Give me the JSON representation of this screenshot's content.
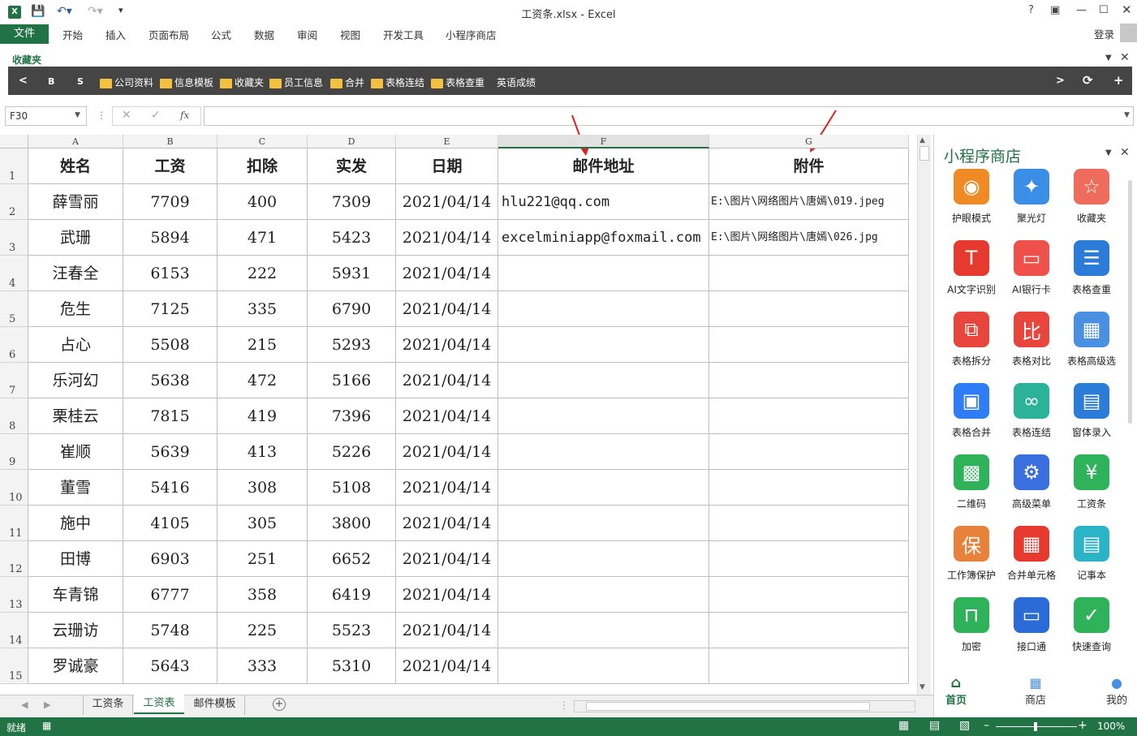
{
  "window": {
    "title": "工资条.xlsx - Excel",
    "signin": "登录",
    "help": "?"
  },
  "ribbon": {
    "file": "文件",
    "tabs": [
      "开始",
      "插入",
      "页面布局",
      "公式",
      "数据",
      "审阅",
      "视图",
      "开发工具",
      "小程序商店"
    ]
  },
  "favorites": {
    "label": "收藏夹",
    "nav_left": "<",
    "b": "B",
    "s": "S",
    "items": [
      "公司资料",
      "信息模板",
      "收藏夹",
      "员工信息",
      "合并",
      "表格连结",
      "表格查重"
    ],
    "extra": "英语成绩",
    "nav_right": ">",
    "refresh": "⟳",
    "add": "+"
  },
  "formula_bar": {
    "name_box": "F30",
    "fx": "fx",
    "value": ""
  },
  "sheet": {
    "columns": [
      "A",
      "B",
      "C",
      "D",
      "E",
      "F",
      "G"
    ],
    "headers": [
      "姓名",
      "工资",
      "扣除",
      "实发",
      "日期",
      "邮件地址",
      "附件"
    ],
    "rows": [
      [
        "薛雪丽",
        "7709",
        "400",
        "7309",
        "2021/04/14",
        "hlu221@qq.com",
        "E:\\图片\\网络图片\\唐嫣\\019.jpeg"
      ],
      [
        "武珊",
        "5894",
        "471",
        "5423",
        "2021/04/14",
        "excelminiapp@foxmail.com",
        "E:\\图片\\网络图片\\唐嫣\\026.jpg"
      ],
      [
        "汪春全",
        "6153",
        "222",
        "5931",
        "2021/04/14",
        "",
        ""
      ],
      [
        "危生",
        "7125",
        "335",
        "6790",
        "2021/04/14",
        "",
        ""
      ],
      [
        "占心",
        "5508",
        "215",
        "5293",
        "2021/04/14",
        "",
        ""
      ],
      [
        "乐河幻",
        "5638",
        "472",
        "5166",
        "2021/04/14",
        "",
        ""
      ],
      [
        "栗桂云",
        "7815",
        "419",
        "7396",
        "2021/04/14",
        "",
        ""
      ],
      [
        "崔顺",
        "5639",
        "413",
        "5226",
        "2021/04/14",
        "",
        ""
      ],
      [
        "董雪",
        "5416",
        "308",
        "5108",
        "2021/04/14",
        "",
        ""
      ],
      [
        "施中",
        "4105",
        "305",
        "3800",
        "2021/04/14",
        "",
        ""
      ],
      [
        "田博",
        "6903",
        "251",
        "6652",
        "2021/04/14",
        "",
        ""
      ],
      [
        "车青锦",
        "6777",
        "358",
        "6419",
        "2021/04/14",
        "",
        ""
      ],
      [
        "云珊访",
        "5748",
        "225",
        "5523",
        "2021/04/14",
        "",
        ""
      ],
      [
        "罗诚豪",
        "5643",
        "333",
        "5310",
        "2021/04/14",
        "",
        ""
      ]
    ],
    "row_numbers": [
      "1",
      "2",
      "3",
      "4",
      "5",
      "6",
      "7",
      "8",
      "9",
      "10",
      "11",
      "12",
      "13",
      "14",
      "15"
    ]
  },
  "sheet_tabs": [
    "工资条",
    "工资表",
    "邮件模板"
  ],
  "active_sheet": "工资表",
  "status": {
    "ready": "就绪",
    "zoom": "100%"
  },
  "panel": {
    "title": "小程序商店",
    "apps": [
      {
        "label": "护眼模式",
        "icon": "eye-icon",
        "color": "#f08a24"
      },
      {
        "label": "聚光灯",
        "icon": "lightbulb-icon",
        "color": "#3a8ee6"
      },
      {
        "label": "收藏夹",
        "icon": "star-folder-icon",
        "color": "#ef6b5b"
      },
      {
        "label": "AI文字识别",
        "icon": "text-t-icon",
        "color": "#e63a2e"
      },
      {
        "label": "AI银行卡",
        "icon": "card-icon",
        "color": "#f0504a"
      },
      {
        "label": "表格查重",
        "icon": "doc-list-icon",
        "color": "#2b7bd8"
      },
      {
        "label": "表格拆分",
        "icon": "split-icon",
        "color": "#e8453c"
      },
      {
        "label": "表格对比",
        "icon": "compare-icon",
        "color": "#e8453c"
      },
      {
        "label": "表格高级选",
        "icon": "grid-icon",
        "color": "#4a90e2"
      },
      {
        "label": "表格合并",
        "icon": "merge-icon",
        "color": "#2f7df6"
      },
      {
        "label": "表格连结",
        "icon": "link-icon",
        "color": "#2bb39a"
      },
      {
        "label": "窗体录入",
        "icon": "form-icon",
        "color": "#2b7bd8"
      },
      {
        "label": "二维码",
        "icon": "qr-icon",
        "color": "#2fb35a"
      },
      {
        "label": "高级菜单",
        "icon": "menu-gear-icon",
        "color": "#3a6fe0"
      },
      {
        "label": "工资条",
        "icon": "payslip-icon",
        "color": "#2fb35a"
      },
      {
        "label": "工作簿保护",
        "icon": "shield-icon",
        "color": "#e8813a"
      },
      {
        "label": "合并单元格",
        "icon": "merge-cells-icon",
        "color": "#e63a2e"
      },
      {
        "label": "记事本",
        "icon": "notebook-icon",
        "color": "#2bb3c8"
      },
      {
        "label": "加密",
        "icon": "lock-icon",
        "color": "#2fb35a"
      },
      {
        "label": "接口通",
        "icon": "monitor-icon",
        "color": "#2b6bd8"
      },
      {
        "label": "快速查询",
        "icon": "search-icon",
        "color": "#2fb35a"
      }
    ],
    "nav": [
      "首页",
      "商店",
      "我的"
    ]
  }
}
